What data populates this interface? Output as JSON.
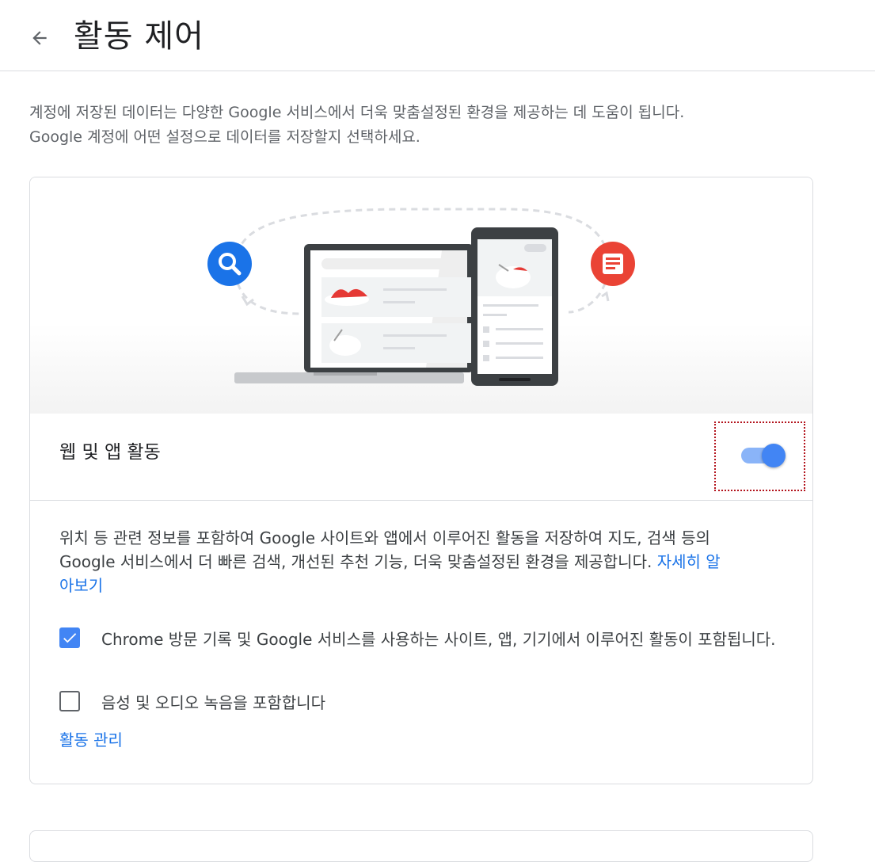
{
  "header": {
    "title": "활동 제어",
    "back_icon": "arrow-left-icon"
  },
  "intro": {
    "line1": "계정에 저장된 데이터는 다양한 Google 서비스에서 더욱 맞춤설정된 환경을 제공하는 데 도움이 됩니다.",
    "line2": "Google 계정에 어떤 설정으로 데이터를 저장할지 선택하세요."
  },
  "activity_card": {
    "illustration_icons": [
      "search-icon",
      "article-icon",
      "laptop-icon",
      "phone-icon"
    ],
    "toggle_label": "웹 및 앱 활동",
    "toggle_on": true,
    "description": "위치 등 관련 정보를 포함하여 Google 사이트와 앱에서 이루어진 활동을 저장하여 지도, 검색 등의 Google 서비스에서 더 빠른 검색, 개선된 추천 기능, 더욱 맞춤설정된 환경을 제공합니다. ",
    "learn_more": "자세히 알아보기",
    "checkboxes": [
      {
        "label": "Chrome 방문 기록 및 Google 서비스를 사용하는 사이트, 앱, 기기에서 이루어진 활동이 포함됩니다.",
        "checked": true
      },
      {
        "label": "음성 및 오디오 녹음을 포함합니다",
        "checked": false
      }
    ],
    "manage_link": "활동 관리"
  },
  "colors": {
    "accent": "#1a73e8",
    "toggle_track": "#8ab4f8",
    "toggle_thumb": "#4285f4",
    "search_circle": "#1a73e8",
    "article_circle": "#ea4335",
    "focus_outline": "#b3141d"
  }
}
